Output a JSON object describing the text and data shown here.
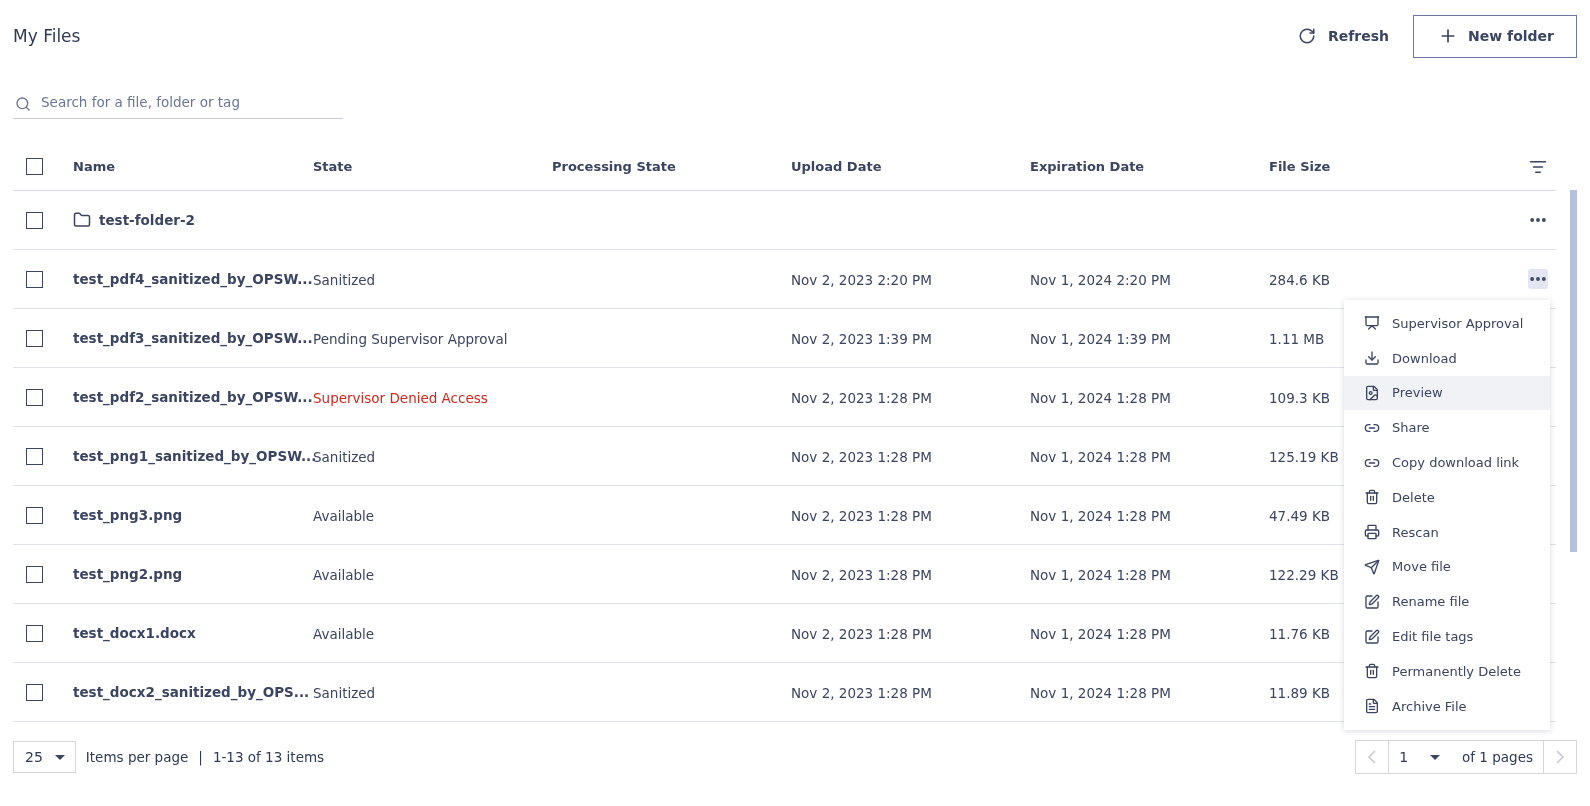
{
  "title": "My Files",
  "actions": {
    "refresh": "Refresh",
    "new_folder": "New folder"
  },
  "search": {
    "placeholder": "Search for a file, folder or tag"
  },
  "table": {
    "select_all_checked": false,
    "columns": [
      "Name",
      "State",
      "Processing State",
      "Upload Date",
      "Expiration Date",
      "File Size"
    ],
    "rows": [
      {
        "kind": "folder",
        "name": "test-folder-2",
        "state": "",
        "upload": "",
        "expiration": "",
        "size": "",
        "checked": false,
        "menu_open": false
      },
      {
        "kind": "file",
        "name": "test_pdf4_sanitized_by_OPSW...",
        "state": "Sanitized",
        "alert": false,
        "upload": "Nov 2, 2023 2:20 PM",
        "expiration": "Nov 1, 2024 2:20 PM",
        "size": "284.6 KB",
        "checked": false,
        "menu_open": true
      },
      {
        "kind": "file",
        "name": "test_pdf3_sanitized_by_OPSW...",
        "state": "Pending Supervisor Approval",
        "alert": false,
        "upload": "Nov 2, 2023 1:39 PM",
        "expiration": "Nov 1, 2024 1:39 PM",
        "size": "1.11 MB",
        "checked": false,
        "menu_open": false
      },
      {
        "kind": "file",
        "name": "test_pdf2_sanitized_by_OPSW...",
        "state": "Supervisor Denied Access",
        "alert": true,
        "upload": "Nov 2, 2023 1:28 PM",
        "expiration": "Nov 1, 2024 1:28 PM",
        "size": "109.3 KB",
        "checked": false,
        "menu_open": false
      },
      {
        "kind": "file",
        "name": "test_png1_sanitized_by_OPSW...",
        "state": "Sanitized",
        "alert": false,
        "upload": "Nov 2, 2023 1:28 PM",
        "expiration": "Nov 1, 2024 1:28 PM",
        "size": "125.19 KB",
        "checked": false,
        "menu_open": false
      },
      {
        "kind": "file",
        "name": "test_png3.png",
        "state": "Available",
        "alert": false,
        "upload": "Nov 2, 2023 1:28 PM",
        "expiration": "Nov 1, 2024 1:28 PM",
        "size": "47.49 KB",
        "checked": false,
        "menu_open": false
      },
      {
        "kind": "file",
        "name": "test_png2.png",
        "state": "Available",
        "alert": false,
        "upload": "Nov 2, 2023 1:28 PM",
        "expiration": "Nov 1, 2024 1:28 PM",
        "size": "122.29 KB",
        "checked": false,
        "menu_open": false
      },
      {
        "kind": "file",
        "name": "test_docx1.docx",
        "state": "Available",
        "alert": false,
        "upload": "Nov 2, 2023 1:28 PM",
        "expiration": "Nov 1, 2024 1:28 PM",
        "size": "11.76 KB",
        "checked": false,
        "menu_open": false
      },
      {
        "kind": "file",
        "name": "test_docx2_sanitized_by_OPS...",
        "state": "Sanitized",
        "alert": false,
        "upload": "Nov 2, 2023 1:28 PM",
        "expiration": "Nov 1, 2024 1:28 PM",
        "size": "11.89 KB",
        "checked": false,
        "menu_open": false
      }
    ]
  },
  "context_menu": [
    {
      "label": "Supervisor Approval",
      "highlighted": false
    },
    {
      "label": "Download",
      "highlighted": false
    },
    {
      "label": "Preview",
      "highlighted": true
    },
    {
      "label": "Share",
      "highlighted": false
    },
    {
      "label": "Copy download link",
      "highlighted": false
    },
    {
      "label": "Delete",
      "highlighted": false
    },
    {
      "label": "Rescan",
      "highlighted": false
    },
    {
      "label": "Move file",
      "highlighted": false
    },
    {
      "label": "Rename file",
      "highlighted": false
    },
    {
      "label": "Edit file tags",
      "highlighted": false
    },
    {
      "label": "Permanently Delete",
      "highlighted": false
    },
    {
      "label": "Archive File",
      "highlighted": false
    }
  ],
  "pagination": {
    "per_page": "25",
    "per_page_label": "Items per page",
    "separator": "|",
    "range": "1-13 of 13 items",
    "page": "1",
    "of_pages": "of 1 pages",
    "prev_disabled": true,
    "next_disabled": true
  }
}
